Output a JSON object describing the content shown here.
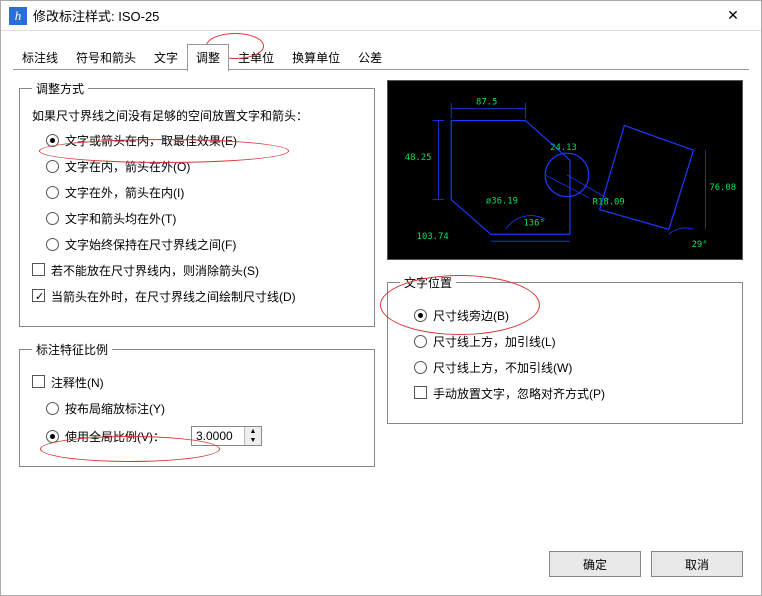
{
  "titlebar": {
    "title": "修改标注样式: ISO-25"
  },
  "tabs": [
    "标注线",
    "符号和箭头",
    "文字",
    "调整",
    "主单位",
    "换算单位",
    "公差"
  ],
  "active_tab_index": 3,
  "fit_method": {
    "legend": "调整方式",
    "desc": "如果尺寸界线之间没有足够的空间放置文字和箭头：",
    "options": [
      "文字或箭头在内，取最佳效果(E)",
      "文字在内，箭头在外(O)",
      "文字在外，箭头在内(I)",
      "文字和箭头均在外(T)",
      "文字始终保持在尺寸界线之间(F)"
    ],
    "selected": 0,
    "cb_suppress": {
      "label": "若不能放在尺寸界线内，则消除箭头(S)",
      "checked": false
    },
    "cb_force": {
      "label": "当箭头在外时，在尺寸界线之间绘制尺寸线(D)",
      "checked": true
    }
  },
  "scale": {
    "legend": "标注特征比例",
    "cb_annotative": {
      "label": "注释性(N)",
      "checked": false
    },
    "options": [
      "按布局缩放标注(Y)",
      "使用全局比例(V)："
    ],
    "selected": 1,
    "value": "3.0000"
  },
  "text_pos": {
    "legend": "文字位置",
    "options": [
      "尺寸线旁边(B)",
      "尺寸线上方，加引线(L)",
      "尺寸线上方，不加引线(W)"
    ],
    "selected": 0,
    "cb_manual": {
      "label": "手动放置文字，忽略对齐方式(P)",
      "checked": false
    }
  },
  "preview": {
    "dims": {
      "top": "87.5",
      "left": "48.25",
      "right": "76.08",
      "mid": "24.13",
      "diam": "ø36.19",
      "rad": "R18.09",
      "bottom": "103.74",
      "ang1": "136°",
      "ang2": "29°"
    }
  },
  "buttons": {
    "ok": "确定",
    "cancel": "取消"
  }
}
